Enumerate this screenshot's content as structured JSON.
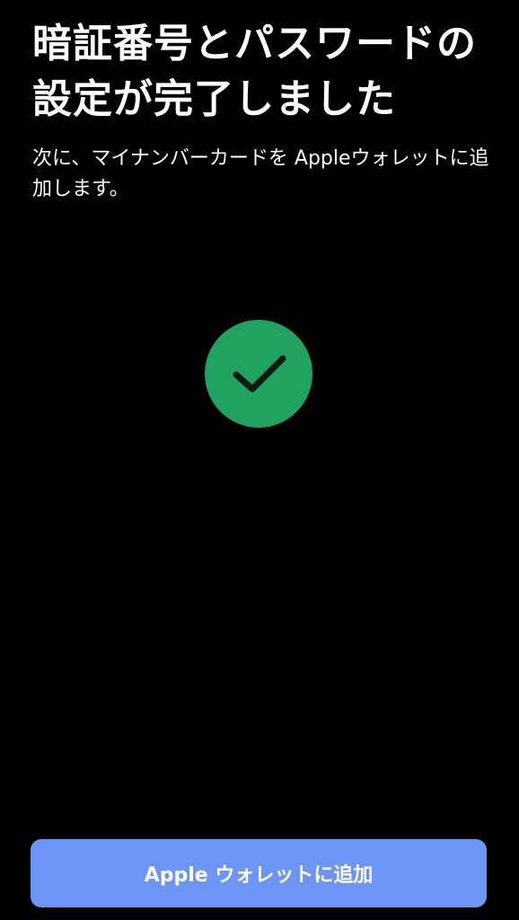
{
  "screen": {
    "title": "暗証番号とパスワードの設定が完了しました",
    "subtitle": "次に、マイナンバーカードを Appleウォレットに追加します。"
  },
  "status": {
    "icon": "checkmark-circle-icon",
    "color": "#20a361"
  },
  "actions": {
    "primary_label": "Apple ウォレットに追加",
    "primary_color": "#6d95f5"
  }
}
